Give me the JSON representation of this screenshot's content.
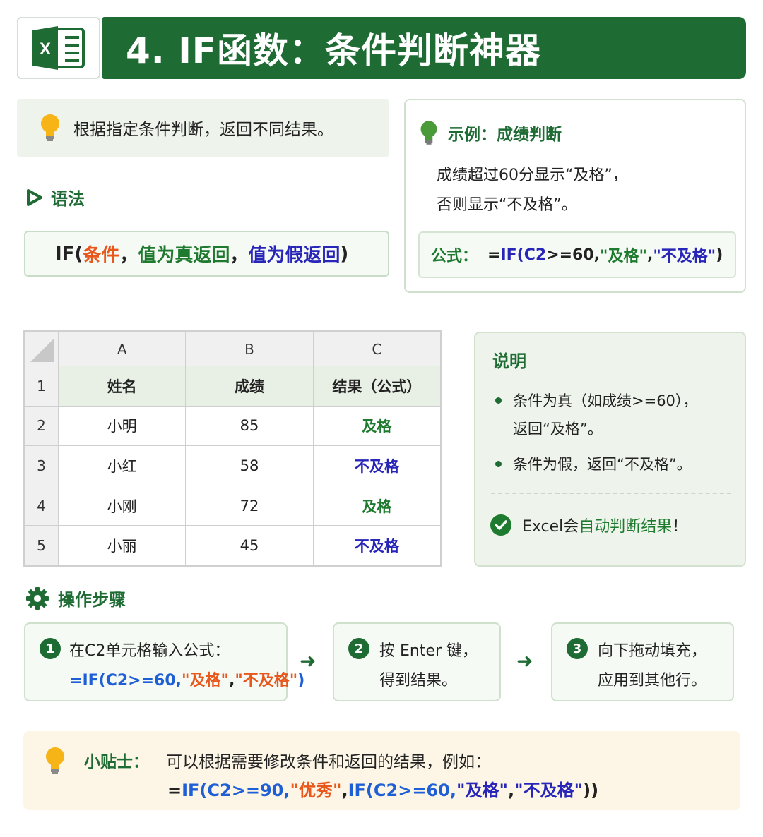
{
  "header": {
    "title": "4. IF函数：条件判断神器",
    "logo_letter": "X"
  },
  "intro": {
    "text": "根据指定条件判断，返回不同结果。"
  },
  "syntax": {
    "heading": "语法",
    "prefix": "IF(",
    "arg1": "条件",
    "sep1": "，",
    "arg2": "值为真返回",
    "sep2": "，",
    "arg3": "值为假返回",
    "suffix": ")"
  },
  "example": {
    "title": "示例：成绩判断",
    "line1": "成绩超过60分显示“及格”，",
    "line2": "否则显示“不及格”。",
    "formula_label": "公式：",
    "formula_parts": {
      "eq": "=",
      "fn": "IF(",
      "ref": "C2",
      "cmp": ">=60, ",
      "q1": "\"及格\"",
      "comma": ", ",
      "q2": "\"不及格\"",
      "close": ")"
    }
  },
  "sheet": {
    "columns": [
      "A",
      "B",
      "C"
    ],
    "header_row": {
      "num": "1",
      "cells": [
        "姓名",
        "成绩",
        "结果（公式）"
      ]
    },
    "rows": [
      {
        "num": "2",
        "name": "小明",
        "score": "85",
        "result": "及格",
        "pass": true
      },
      {
        "num": "3",
        "name": "小红",
        "score": "58",
        "result": "不及格",
        "pass": false
      },
      {
        "num": "4",
        "name": "小刚",
        "score": "72",
        "result": "及格",
        "pass": true
      },
      {
        "num": "5",
        "name": "小丽",
        "score": "45",
        "result": "不及格",
        "pass": false
      }
    ]
  },
  "notes": {
    "title": "说明",
    "item1_line1": "条件为真（如成绩>=60），",
    "item1_line2": "返回“及格”。",
    "item2": "条件为假，返回“不及格”。",
    "auto_prefix": "Excel会",
    "auto_highlight": "自动判断结果",
    "auto_suffix": "！"
  },
  "steps": {
    "heading": "操作步骤",
    "step1": {
      "num": "1",
      "line1": "在C2单元格输入公式：",
      "f_eq": "=",
      "f_fn": "IF(",
      "f_ref": "C2",
      "f_cmp": ">=60,",
      "f_q1": "\"及格\"",
      "f_comma": ",",
      "f_q2": "\"不及格\"",
      "f_close": ")"
    },
    "step2": {
      "num": "2",
      "line1": "按 Enter 键，",
      "line2": "得到结果。"
    },
    "step3": {
      "num": "3",
      "line1": "向下拖动填充，",
      "line2": "应用到其他行。"
    },
    "arrow": "➜"
  },
  "tip": {
    "label": "小贴士：",
    "text": "可以根据需要修改条件和返回的结果，例如：",
    "f1": "=",
    "f2": "IF(",
    "f3": "C2",
    "f4": ">=90,",
    "f5": "\"优秀\"",
    "f6": ",",
    "f7": "IF(",
    "f8": "C2",
    "f9": ">=60,",
    "f10": "\"及格\"",
    "f11": ",",
    "f12": "\"不及格\"",
    "f13": "))"
  },
  "colors": {
    "brand_green": "#1e6b34",
    "pass_green": "#1e7a2e",
    "fail_blue": "#2826b8",
    "accent_orange": "#e8571c"
  }
}
